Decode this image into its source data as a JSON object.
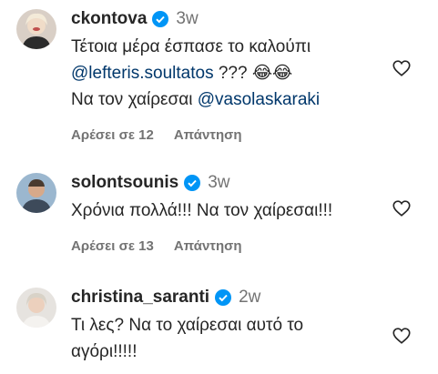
{
  "comments": [
    {
      "username": "ckontova",
      "time": "3w",
      "line1": "Τέτοια μέρα έσπασε το καλούπι",
      "mention1": "@lefteris.soultatos",
      "line2_tail": " ??? 😂😂",
      "line3_prefix": "Να τον χαίρεσαι ",
      "mention2": "@vasolaskaraki",
      "likes": "Αρέσει σε 12",
      "reply": "Απάντηση"
    },
    {
      "username": "solontsounis",
      "time": "3w",
      "text": "Χρόνια πολλά!!! Να τον χαίρεσαι!!!",
      "likes": "Αρέσει σε 13",
      "reply": "Απάντηση"
    },
    {
      "username": "christina_saranti",
      "time": "2w",
      "line1": "Τι λες? Να το χαίρεσαι αυτό το",
      "line2": "αγόρι!!!!!"
    }
  ],
  "icons": {
    "verified_color": "#0095f6",
    "heart": "heart-icon"
  }
}
